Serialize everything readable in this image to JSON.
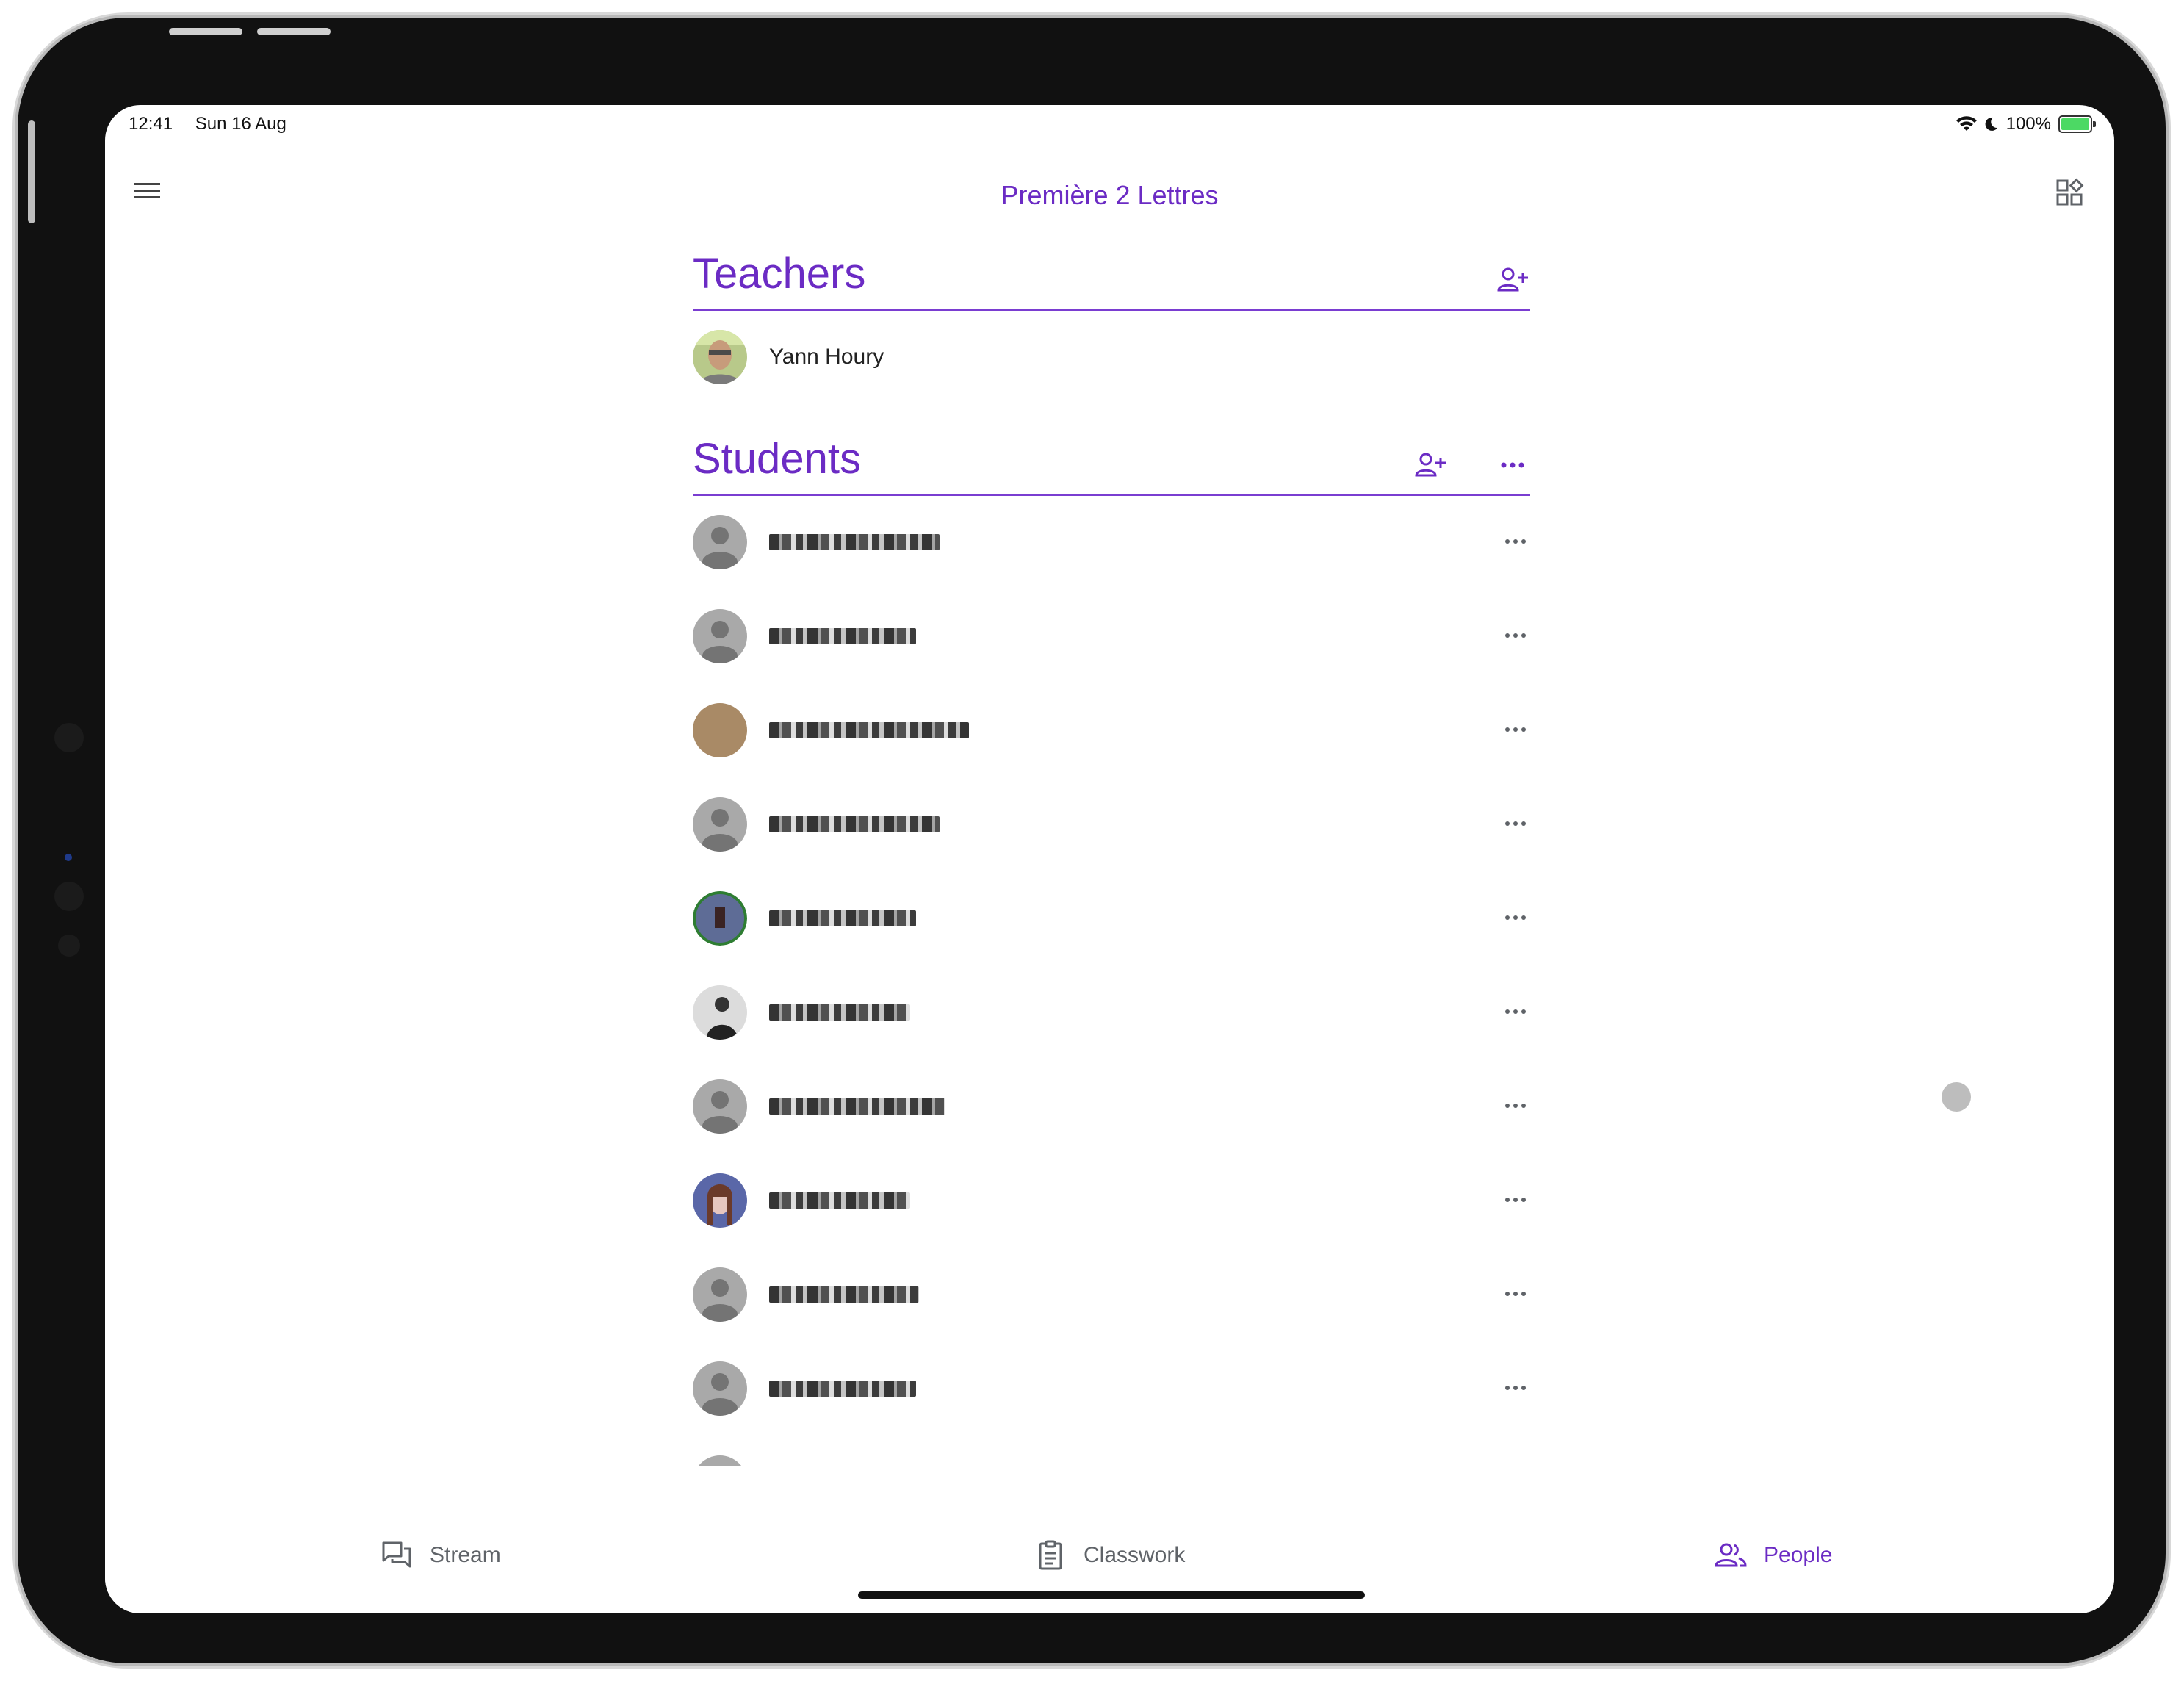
{
  "status_bar": {
    "time": "12:41",
    "date": "Sun 16 Aug",
    "battery": "100%"
  },
  "header": {
    "title": "Première 2 Lettres"
  },
  "teachers": {
    "title": "Teachers",
    "items": [
      {
        "name": "Yann Houry"
      }
    ]
  },
  "students": {
    "title": "Students",
    "count_visible": 11
  },
  "bottom_nav": {
    "tabs": [
      {
        "label": "Stream",
        "icon": "stream-icon"
      },
      {
        "label": "Classwork",
        "icon": "classwork-icon"
      },
      {
        "label": "People",
        "icon": "people-icon",
        "active": true
      }
    ]
  },
  "colors": {
    "accent": "#6b2bc4",
    "text": "#222222",
    "muted": "#5f6368"
  }
}
